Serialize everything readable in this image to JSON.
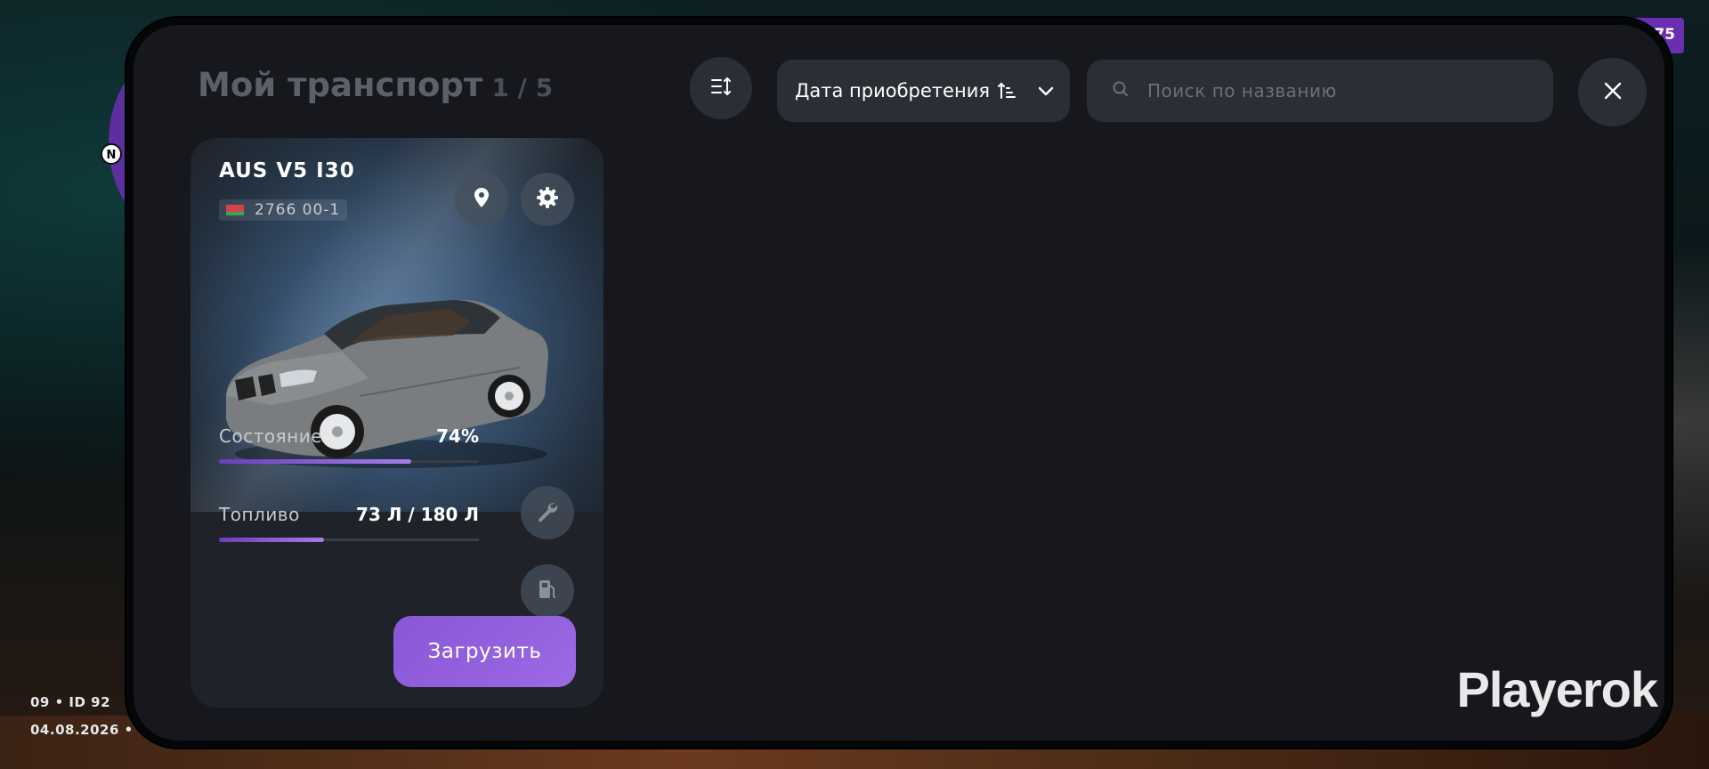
{
  "background": {
    "minimap_north": "N",
    "top_right_badge": "75",
    "hud_line1": "09 • ID 92",
    "hud_line2": "04.08.2026 • ·"
  },
  "header": {
    "title": "Мой транспорт",
    "count": "1 / 5",
    "sort_button_icon": "sort-lines-icon",
    "sort_select": {
      "selected": "Дата приобретения",
      "direction_icon": "sort-ascending-icon",
      "chevron_icon": "chevron-down-icon"
    },
    "search": {
      "placeholder": "Поиск по названию",
      "value": "",
      "icon": "search-icon"
    },
    "close_icon": "close-icon"
  },
  "vehicles": [
    {
      "name": "AUS V5 I30",
      "plate": "2766 00-1",
      "plate_flag_colors": [
        "#d7424a",
        "#3aa35a"
      ],
      "condition_label": "Состояние",
      "condition_value": "74%",
      "condition_fraction": 0.74,
      "fuel_label": "Топливо",
      "fuel_value": "73 Л / 180 Л",
      "fuel_fraction": 0.4056,
      "load_label": "Загрузить",
      "icons": [
        "map-pin-icon",
        "gear-icon",
        "wrench-icon",
        "fuel-pump-icon"
      ]
    }
  ],
  "branding": {
    "watermark": "Playerok"
  },
  "colors": {
    "accent": "#9b6ae3",
    "panel": "#16181d",
    "card": "#1f2228",
    "control": "#2b2e35"
  }
}
